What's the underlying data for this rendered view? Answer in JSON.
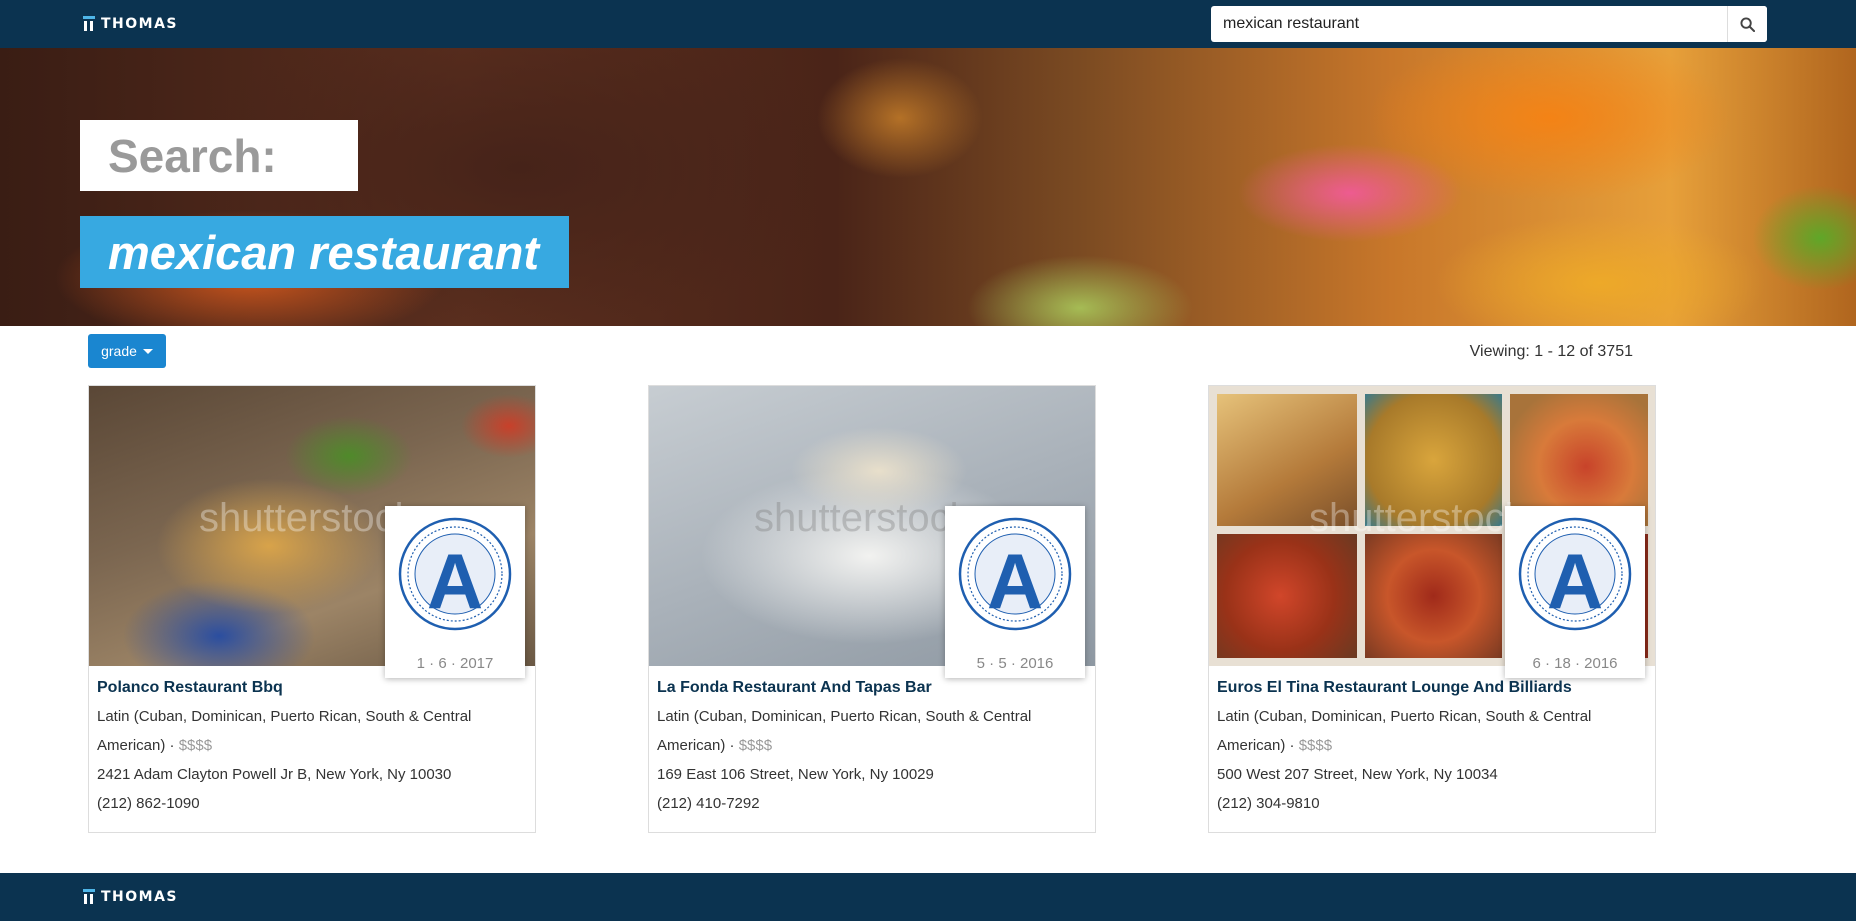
{
  "brand": {
    "name": "THOMAS"
  },
  "search": {
    "value": "mexican restaurant",
    "button_icon": "search-icon"
  },
  "hero": {
    "label": "Search:",
    "query": "mexican restaurant"
  },
  "controls": {
    "sort_label": "grade",
    "viewing_text": "Viewing: 1 - 12 of 3751"
  },
  "results": [
    {
      "name": "Polanco Restaurant Bbq",
      "cuisine": "Latin (Cuban, Dominican, Puerto Rican, South & Central American)",
      "separator": "·",
      "price": "$$$$",
      "address": "2421 Adam Clayton Powell Jr B, New York, Ny 10030",
      "phone": "(212) 862-1090",
      "grade": "A",
      "grade_date": "1 · 6 · 2017"
    },
    {
      "name": "La Fonda Restaurant And Tapas Bar",
      "cuisine": "Latin (Cuban, Dominican, Puerto Rican, South & Central American)",
      "separator": "·",
      "price": "$$$$",
      "address": "169 East 106 Street, New York, Ny 10029",
      "phone": "(212) 410-7292",
      "grade": "A",
      "grade_date": "5 · 5 · 2016"
    },
    {
      "name": "Euros El Tina Restaurant Lounge And Billiards",
      "cuisine": "Latin (Cuban, Dominican, Puerto Rican, South & Central American)",
      "separator": "·",
      "price": "$$$$",
      "address": "500 West 207 Street, New York, Ny 10034",
      "phone": "(212) 304-9810",
      "grade": "A",
      "grade_date": "6 · 18 · 2016"
    }
  ],
  "footer": {
    "brand": "THOMAS"
  },
  "colors": {
    "nav": "#0b3350",
    "accent": "#37a9e1",
    "button": "#1a86d0",
    "grade_blue": "#1f5fb0"
  }
}
